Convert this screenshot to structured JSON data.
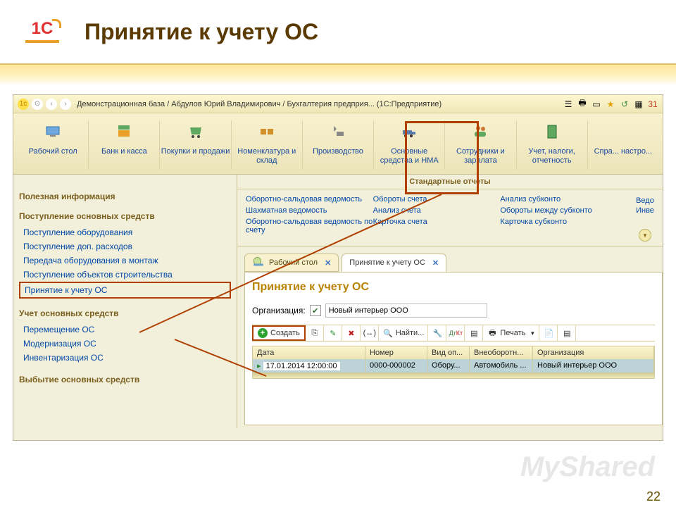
{
  "slide": {
    "title": "Принятие к учету ОС",
    "pagenum": "22",
    "watermark": "MyShared"
  },
  "titlebar": {
    "text": "Демонстрационная база / Абдулов Юрий Владимирович / Бухгалтерия предприя...  (1С:Предприятие)"
  },
  "sections": [
    {
      "label": "Рабочий стол"
    },
    {
      "label": "Банк и касса"
    },
    {
      "label": "Покупки и продажи"
    },
    {
      "label": "Номенклатура и склад"
    },
    {
      "label": "Производство"
    },
    {
      "label": "Основные средства и НМА"
    },
    {
      "label": "Сотрудники и зарплата"
    },
    {
      "label": "Учет, налоги, отчетность"
    },
    {
      "label": "Спра... настро..."
    }
  ],
  "aside": {
    "useful": "Полезная информация",
    "group1": {
      "title": "Поступление основных средств",
      "items": [
        "Поступление оборудования",
        "Поступление доп. расходов",
        "Передача оборудования в монтаж",
        "Поступление объектов строительства",
        "Принятие к учету ОС"
      ]
    },
    "group2": {
      "title": "Учет основных средств",
      "items": [
        "Перемещение ОС",
        "Модернизация ОС",
        "Инвентаризация ОС"
      ]
    },
    "group3": {
      "title": "Выбытие основных средств"
    }
  },
  "std": {
    "title": "Стандартные отчеты",
    "col1": [
      "Оборотно-сальдовая ведомость",
      "Шахматная ведомость",
      "Оборотно-сальдовая ведомость по счету"
    ],
    "col2": [
      "Обороты счета",
      "Анализ счета",
      "Карточка счета"
    ],
    "col3": [
      "Анализ субконто",
      "Обороты между субконто",
      "Карточка субконто"
    ],
    "side": [
      "Ведо",
      "Инве"
    ]
  },
  "tabs": [
    {
      "label": "Рабочий стол",
      "active": false
    },
    {
      "label": "Принятие к учету ОС",
      "active": true
    }
  ],
  "panel": {
    "title": "Принятие к учету ОС",
    "org_label": "Организация:",
    "org_value": "Новый интерьер ООО",
    "toolbar": {
      "create": "Создать",
      "find": "Найти...",
      "print": "Печать"
    },
    "table": {
      "headers": [
        "Дата",
        "Номер",
        "Вид оп...",
        "Внеоборотн...",
        "Организация"
      ],
      "row": [
        "17.01.2014 12:00:00",
        "0000-000002",
        "Обору...",
        "Автомобиль ...",
        "Новый интерьер ООО"
      ]
    }
  }
}
